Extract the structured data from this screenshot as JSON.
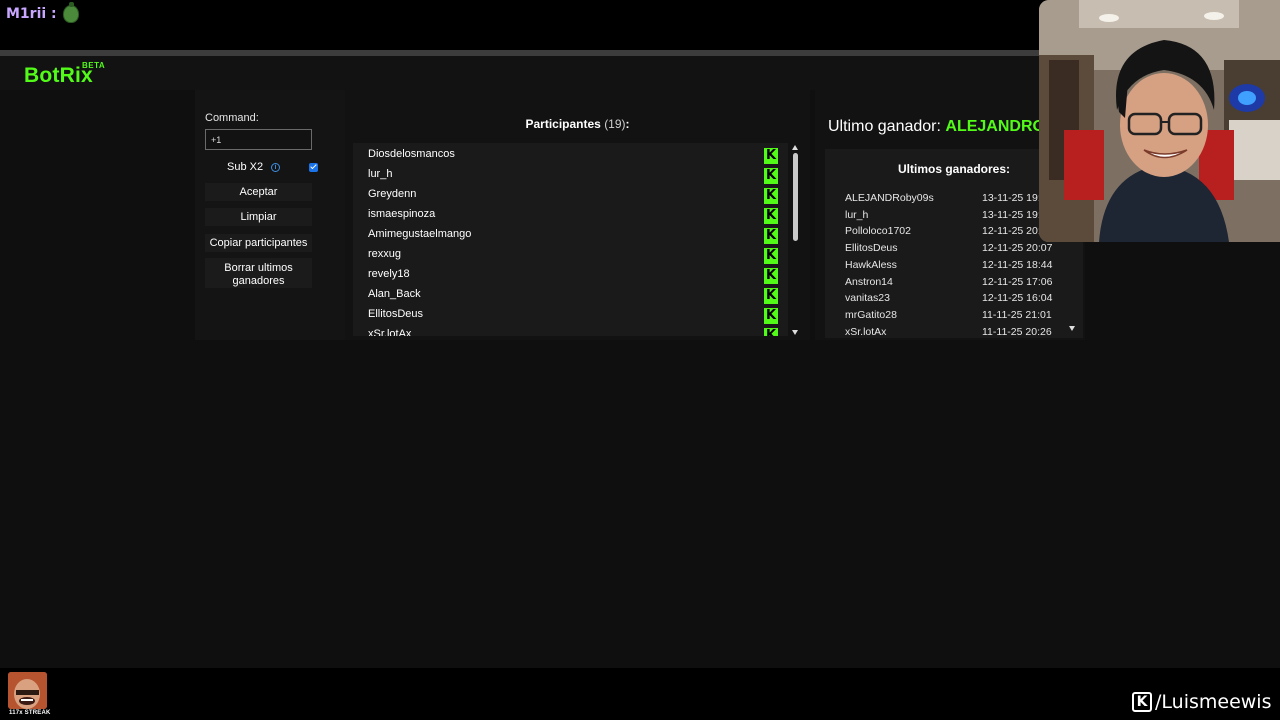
{
  "chat": {
    "user": "M1rii :",
    "emote": "pepe-emote"
  },
  "app": {
    "name": "BotRix",
    "badge": "BETA"
  },
  "controls": {
    "command_label": "Command:",
    "command_value": "+1",
    "sub_label": "Sub X2",
    "sub_checked": true,
    "accept": "Aceptar",
    "clear": "Limpiar",
    "copy": "Copiar participantes",
    "delete_line1": "Borrar ultimos",
    "delete_line2": "ganadores"
  },
  "participants": {
    "title": "Participantes",
    "count": "(19)",
    "colon": ":",
    "items": [
      "Diosdelosmancos",
      "lur_h",
      "Greydenn",
      "ismaespinoza",
      "Amimegustaelmango",
      "rexxug",
      "revely18",
      "Alan_Back",
      "EllitosDeus",
      "xSr.lotAx"
    ]
  },
  "winners": {
    "last_winner_label": "Ultimo ganador:",
    "last_winner_name": "ALEJANDRO",
    "list_title": "Ultimos ganadores:",
    "rows": [
      {
        "name": "ALEJANDRoby09s",
        "date": "13-11-25 19:"
      },
      {
        "name": "lur_h",
        "date": "13-11-25 19:"
      },
      {
        "name": "Polloloco1702",
        "date": "12-11-25 20:"
      },
      {
        "name": "EllitosDeus",
        "date": "12-11-25 20:07"
      },
      {
        "name": "HawkAless",
        "date": "12-11-25 18:44"
      },
      {
        "name": "Anstron14",
        "date": "12-11-25 17:06"
      },
      {
        "name": "vanitas23",
        "date": "12-11-25 16:04"
      },
      {
        "name": "mrGatito28",
        "date": "11-11-25 21:01"
      },
      {
        "name": "xSr.lotAx",
        "date": "11-11-25 20:26"
      }
    ]
  },
  "overlay": {
    "streak": "117x STREAK",
    "channel": "/Luismeewis",
    "kick_letter": "K"
  },
  "colors": {
    "accent": "#53fc18",
    "background": "#0f0f0f",
    "panel": "#121212"
  }
}
